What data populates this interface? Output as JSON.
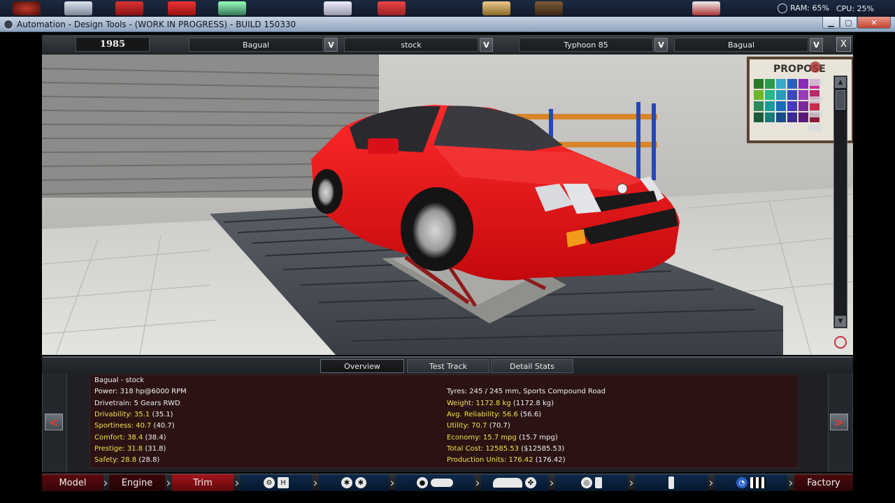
{
  "system": {
    "ram_label": "RAM: 65%",
    "cpu_label": "CPU: 25%"
  },
  "window": {
    "title": "Automation - Design Tools - (WORK IN PROGRESS) - BUILD 150330",
    "close_glyph": "✕",
    "min_glyph": "▁",
    "max_glyph": "▢"
  },
  "top_bar": {
    "year": "1985",
    "model_select": "Bagual",
    "trim_select": "stock",
    "engine_family_select": "Typhoon 85",
    "engine_variant_select": "Bagual",
    "dropdown_glyph": "V",
    "close_glyph": "X"
  },
  "viewport": {
    "poster_text": "PROPOSE",
    "scroll_up": "▲",
    "scroll_down": "▼"
  },
  "tabs": [
    {
      "label": "Overview",
      "active": true
    },
    {
      "label": "Test Track",
      "active": false
    },
    {
      "label": "Detail Stats",
      "active": false
    }
  ],
  "overview": {
    "heading": "Bagual - stock",
    "left": [
      {
        "label": "Power: 318 hp@6000 RPM",
        "extra": "",
        "color": "white"
      },
      {
        "label": "Drivetrain: 5 Gears RWD",
        "extra": "",
        "color": "white"
      },
      {
        "label": "Drivability: 35.1",
        "extra": "(35.1)",
        "color": "yellow"
      },
      {
        "label": "Sportiness: 40.7",
        "extra": "(40.7)",
        "color": "yellow"
      },
      {
        "label": "Comfort: 38.4",
        "extra": "(38.4)",
        "color": "yellow"
      },
      {
        "label": "Prestige: 31.8",
        "extra": "(31.8)",
        "color": "yellow"
      },
      {
        "label": "Safety: 28.8",
        "extra": "(28.8)",
        "color": "yellow"
      }
    ],
    "right": [
      {
        "label": "Tyres: 245 / 245 mm, Sports Compound Road",
        "extra": "",
        "color": "white"
      },
      {
        "label": "Weight: 1172.8 kg",
        "extra": "(1172.8 kg)",
        "color": "yellow"
      },
      {
        "label": "Avg. Reliability: 56.6",
        "extra": "(56.6)",
        "color": "yellow"
      },
      {
        "label": "Utility: 70.7",
        "extra": "(70.7)",
        "color": "yellow"
      },
      {
        "label": "Economy: 15.7 mpg",
        "extra": "(15.7 mpg)",
        "color": "yellow"
      },
      {
        "label": "Total Cost: 12585.53",
        "extra": "($12585.53)",
        "color": "yellow"
      },
      {
        "label": "Production Units: 176.42",
        "extra": "(176.42)",
        "color": "yellow"
      }
    ],
    "prev_glyph": "<",
    "next_glyph": ">"
  },
  "bottom_nav": {
    "model": "Model",
    "engine": "Engine",
    "trim": "Trim",
    "factory": "Factory",
    "icons": [
      "gearbox-icon",
      "wheels-icon",
      "body-icon",
      "aero-icon",
      "interior-icon",
      "suspension-icon",
      "test-icon"
    ]
  },
  "colors": {
    "accent_red": "#c11b22",
    "stat_yellow": "#f2e14a",
    "car_red": "#e0151a"
  }
}
